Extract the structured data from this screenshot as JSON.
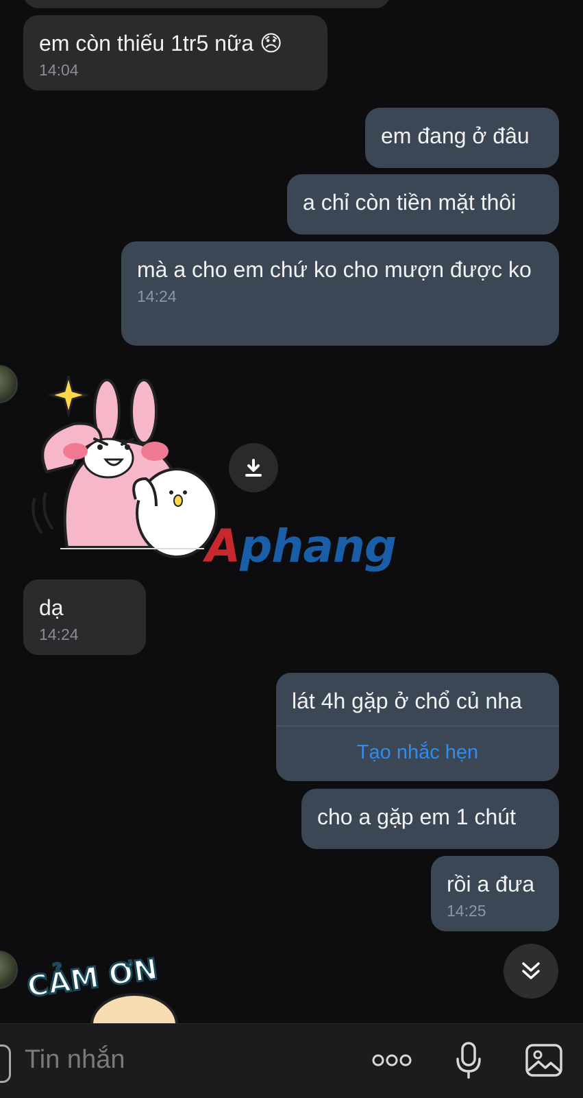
{
  "messages": {
    "m1": {
      "text": "em còn thiếu 1tr5 nữa 😞",
      "time": "14:04"
    },
    "m2": {
      "text": "em đang ở đâu"
    },
    "m3": {
      "text": "a chỉ còn tiền mặt thôi"
    },
    "m4": {
      "text": "mà a cho em chứ ko cho mượn được ko",
      "time": "14:24"
    },
    "m5": {
      "text": "dạ",
      "time": "14:24"
    },
    "m6": {
      "text": "lát 4h gặp ở chổ củ nha",
      "action": "Tạo nhắc hẹn"
    },
    "m7": {
      "text": "cho a gặp em 1 chút"
    },
    "m8": {
      "text": "rồi a đưa",
      "time": "14:25"
    }
  },
  "stickers": {
    "thanks_text": "CẢM ƠN"
  },
  "watermark": "Aphang",
  "input": {
    "placeholder": "Tin nhắn"
  },
  "icons": {
    "download": "download-icon",
    "scroll_down": "double-chevron-down-icon",
    "more": "more-dots-icon",
    "mic": "microphone-icon",
    "image": "image-icon"
  },
  "colors": {
    "background": "#0d0d0f",
    "incoming_bubble": "#2b2b2d",
    "outgoing_bubble": "#3b4754",
    "link": "#2f8cf0"
  }
}
